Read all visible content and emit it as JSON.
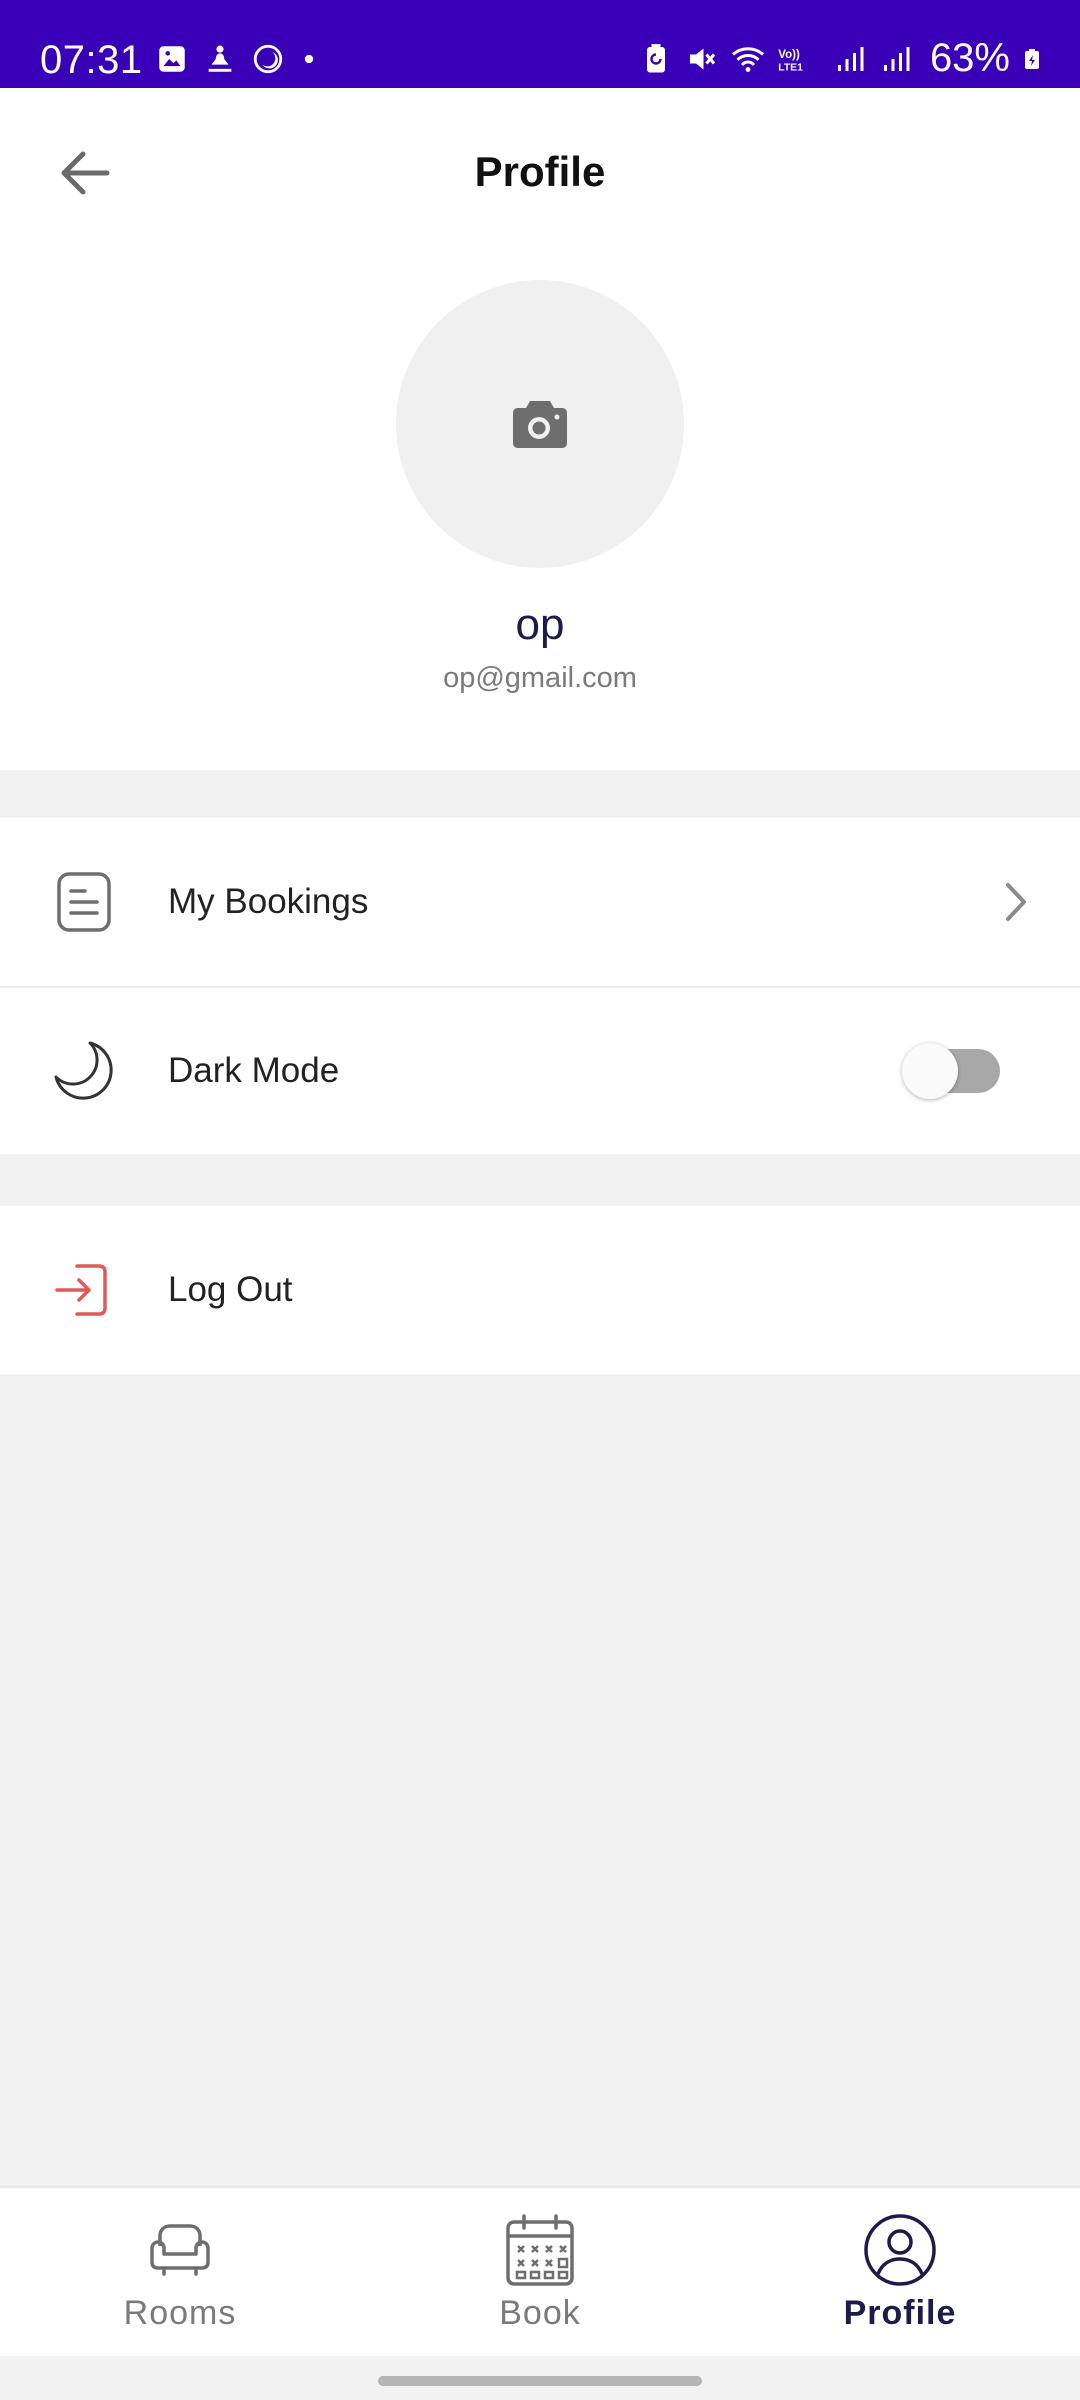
{
  "status_bar": {
    "time": "07:31",
    "battery": "63%",
    "left_icons": [
      "gallery-icon",
      "meditation-icon",
      "moon-ring-icon",
      "dot-icon"
    ],
    "right_icons": [
      "battery-saver-icon",
      "mute-icon",
      "wifi-icon",
      "volte-icon",
      "signal-icon",
      "signal-icon",
      "battery-icon"
    ],
    "volte_label": "Vo)) LTE1"
  },
  "header": {
    "title": "Profile",
    "back_icon": "arrow-left-icon"
  },
  "profile": {
    "avatar_icon": "camera-icon",
    "name": "op",
    "email": "op@gmail.com"
  },
  "menu": {
    "bookings_label": "My Bookings",
    "dark_mode_label": "Dark Mode",
    "dark_mode_enabled": false,
    "logout_label": "Log Out"
  },
  "bottom_nav": {
    "items": [
      {
        "label": "Rooms",
        "icon": "armchair-icon",
        "active": false
      },
      {
        "label": "Book",
        "icon": "calendar-icon",
        "active": false
      },
      {
        "label": "Profile",
        "icon": "user-circle-icon",
        "active": true
      }
    ]
  },
  "colors": {
    "status_bar": "#3a00b8",
    "accent": "#1e1a4a",
    "logout": "#e05a5a",
    "background": "#f2f2f2"
  }
}
